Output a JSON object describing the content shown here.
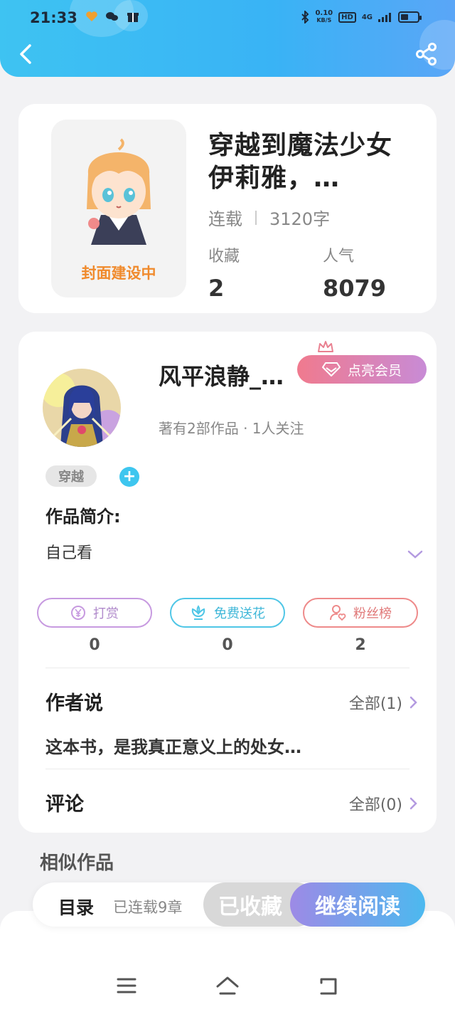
{
  "status_bar": {
    "time": "21:33",
    "net_speed_value": "0.10",
    "net_speed_unit": "KB/S",
    "hd": "HD",
    "signal": "4G"
  },
  "book": {
    "title": "穿越到魔法少女伊莉雅，…",
    "cover_text": "封面建设中",
    "status": "连载",
    "word_count": "3120字",
    "favorites_label": "收藏",
    "favorites_value": "2",
    "popularity_label": "人气",
    "popularity_value": "8079"
  },
  "author": {
    "name": "风平浪静_…",
    "vip_label": "点亮会员",
    "meta": "著有2部作品 · 1人关注"
  },
  "tags": [
    "穿越"
  ],
  "intro": {
    "title": "作品简介:",
    "text": "自己看"
  },
  "actions": [
    {
      "label": "打赏",
      "count": "0",
      "color": "#c79ae0"
    },
    {
      "label": "免费送花",
      "count": "0",
      "color": "#4fc6e6"
    },
    {
      "label": "粉丝榜",
      "count": "2",
      "color": "#ee8a8a"
    }
  ],
  "author_say": {
    "title": "作者说",
    "all_label": "全部(1)",
    "text": "这本书，是我真正意义上的处女…"
  },
  "comments": {
    "title": "评论",
    "all_label": "全部(0)"
  },
  "similar_title": "相似作品",
  "bottom_bar": {
    "toc_label": "目录",
    "toc_sub": "已连载9章",
    "collected_label": "已收藏",
    "read_label": "继续阅读"
  },
  "colors": {
    "header_start": "#3ec3f2",
    "header_end": "#5aa6f7",
    "cover_text": "#f08a2c",
    "tag_add": "#3ec6ef"
  }
}
